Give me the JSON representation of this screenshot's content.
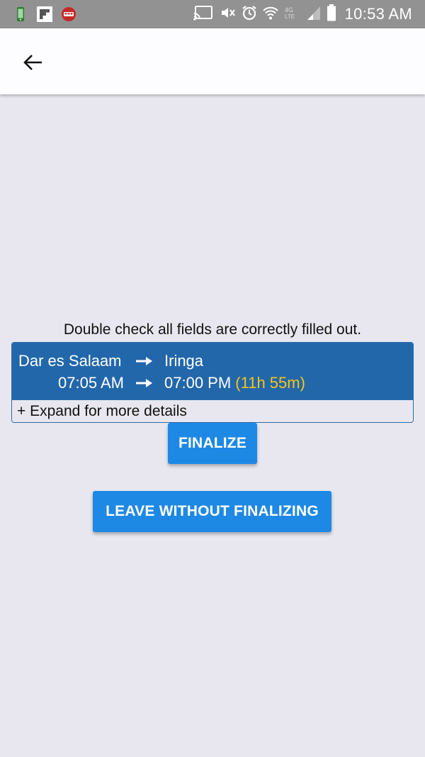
{
  "status_bar": {
    "time": "10:53 AM",
    "notification_icons": [
      "phone-app-icon",
      "flipboard-icon",
      "bus-app-icon"
    ],
    "system_icons": [
      "cast-icon",
      "vibrate-mute-icon",
      "alarm-icon",
      "wifi-icon",
      "lte-icon",
      "signal-icon",
      "battery-icon"
    ],
    "lte_label": "4G LTE"
  },
  "app_bar": {
    "back_icon": "arrow-back-icon"
  },
  "content": {
    "instruction": "Double check all fields are correctly filled out.",
    "trip": {
      "origin": "Dar es Salaam",
      "destination": "Iringa",
      "departure_time": "07:05 AM",
      "arrival_time": "07:00 PM",
      "duration": "(11h 55m)",
      "expand_label": "+ Expand for more details"
    },
    "buttons": {
      "finalize": "FINALIZE",
      "leave": "LEAVE WITHOUT FINALIZING"
    }
  },
  "colors": {
    "status_bar": "#929292",
    "app_bar": "#fdfcff",
    "background": "#e8e7ef",
    "card_header": "#2367ab",
    "duration": "#f5c518",
    "button": "#1e88e5"
  }
}
